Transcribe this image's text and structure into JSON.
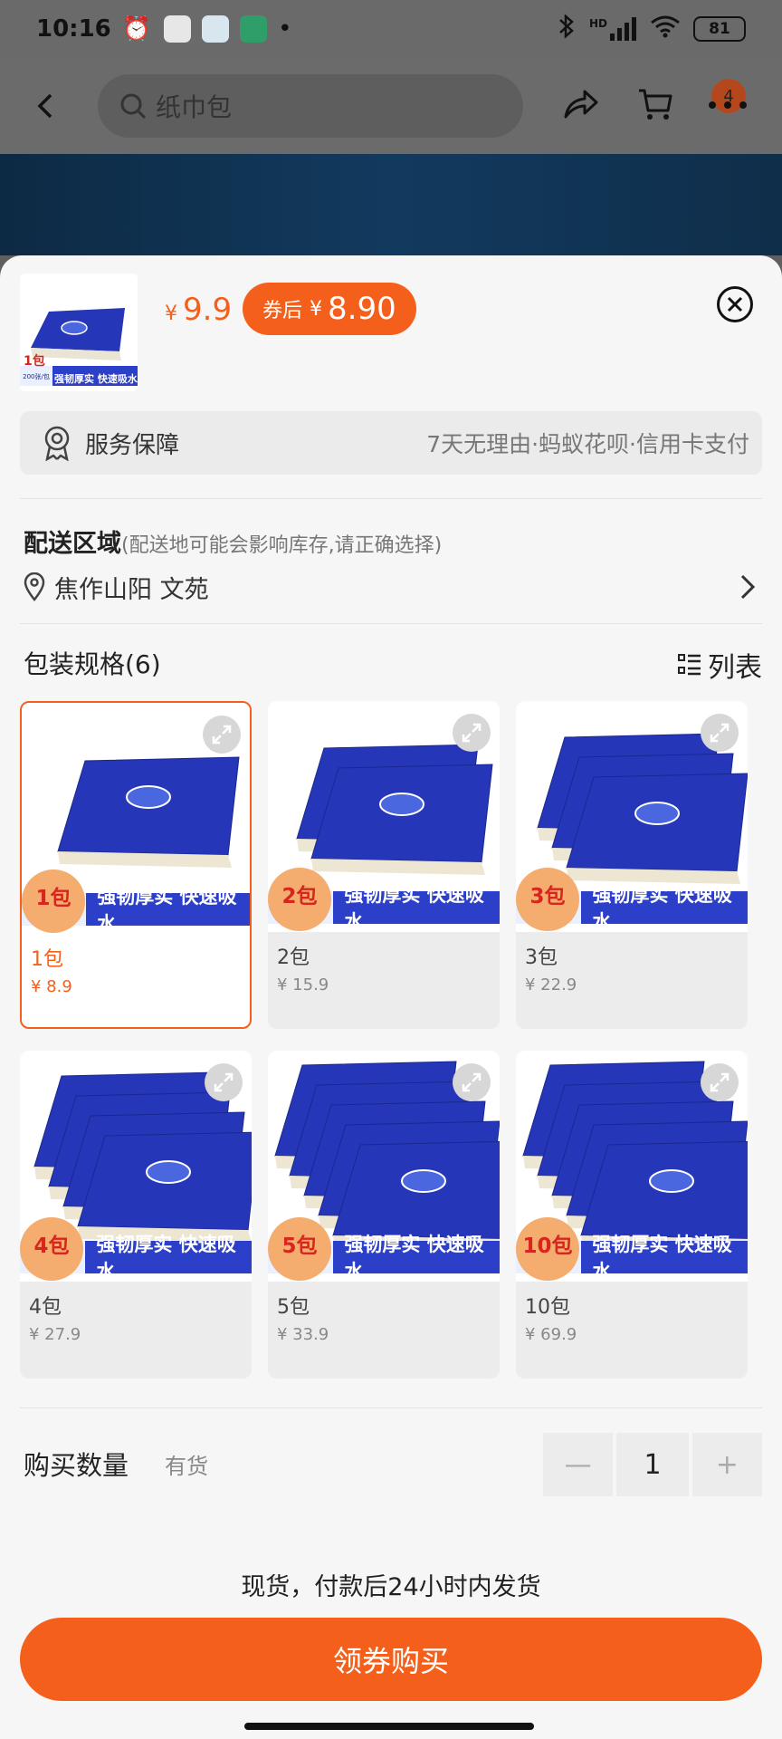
{
  "status_bar": {
    "time": "10:16",
    "battery": "81",
    "network": "HD"
  },
  "top_nav": {
    "search_placeholder": "纸巾包",
    "cart_badge": "4"
  },
  "product": {
    "thumb_pack": "1包",
    "thumb_cnt": "200张/包",
    "thumb_tags": "强韧厚实 快速吸水",
    "price_yen": "¥",
    "price": "9.9",
    "coupon_label": "券后",
    "coupon_yen": "¥",
    "coupon_price": "8.90"
  },
  "service": {
    "title": "服务保障",
    "desc": "7天无理由·蚂蚁花呗·信用卡支付"
  },
  "delivery": {
    "title": "配送区域",
    "subtitle": "(配送地可能会影响库存,请正确选择)",
    "location": "焦作山阳 文苑"
  },
  "spec": {
    "title": "包装规格(6)",
    "list_label": "列表"
  },
  "ribbon": {
    "count": "200张/包",
    "tags": "强韧厚实  快速吸水"
  },
  "options": [
    {
      "badge": "1包",
      "label": "1包",
      "price": "¥ 8.9",
      "selected": true,
      "stack": 1
    },
    {
      "badge": "2包",
      "label": "2包",
      "price": "¥ 15.9",
      "selected": false,
      "stack": 2
    },
    {
      "badge": "3包",
      "label": "3包",
      "price": "¥ 22.9",
      "selected": false,
      "stack": 3
    },
    {
      "badge": "4包",
      "label": "4包",
      "price": "¥ 27.9",
      "selected": false,
      "stack": 4
    },
    {
      "badge": "5包",
      "label": "5包",
      "price": "¥ 33.9",
      "selected": false,
      "stack": 5
    },
    {
      "badge": "10包",
      "label": "10包",
      "price": "¥ 69.9",
      "selected": false,
      "stack": 10
    }
  ],
  "quantity": {
    "label": "购买数量",
    "stock": "有货",
    "value": "1",
    "minus": "—",
    "plus": "+"
  },
  "shipping_note": "现货，付款后24小时内发货",
  "buy_button": "领券购买",
  "colors": {
    "accent": "#f4601b",
    "ribbon": "#2c3fc8"
  }
}
